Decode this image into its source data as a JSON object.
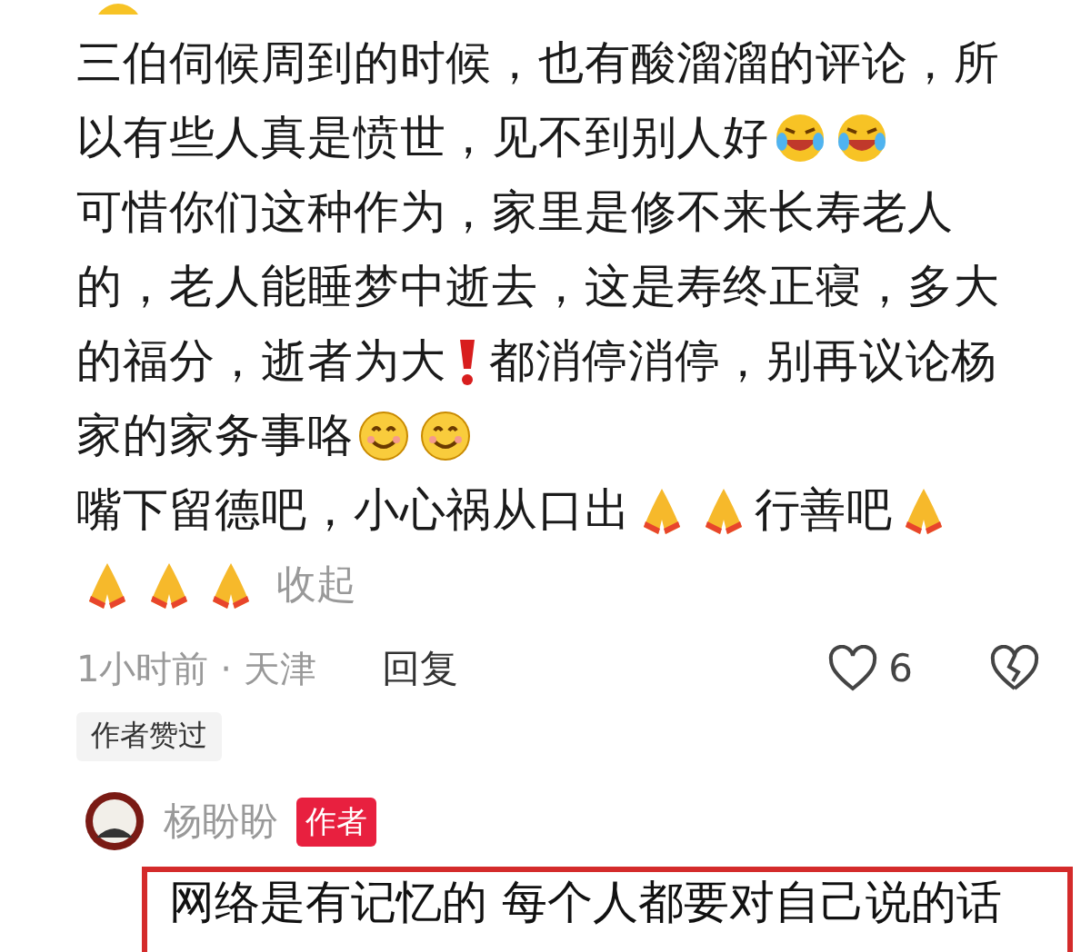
{
  "comment": {
    "lines": [
      [
        {
          "kind": "text",
          "text": "三伯伺候周到的时候，也有酸溜溜的评论，所"
        }
      ],
      [
        {
          "kind": "text",
          "text": "以有些人真是愤世，见不到别人好"
        },
        {
          "kind": "laugh"
        },
        {
          "kind": "laugh"
        }
      ],
      [
        {
          "kind": "text",
          "text": "可惜你们这种作为，家里是修不来长寿老人"
        }
      ],
      [
        {
          "kind": "text",
          "text": "的，老人能睡梦中逝去，这是寿终正寝，多大"
        }
      ],
      [
        {
          "kind": "text",
          "text": "的福分，逝者为大"
        },
        {
          "kind": "exclamation"
        },
        {
          "kind": "text",
          "text": "都消停消停，别再议论杨"
        }
      ],
      [
        {
          "kind": "text",
          "text": "家的家务事咯"
        },
        {
          "kind": "smile"
        },
        {
          "kind": "smile"
        }
      ],
      [
        {
          "kind": "text",
          "text": "嘴下留德吧，小心祸从口出"
        },
        {
          "kind": "pray"
        },
        {
          "kind": "pray"
        },
        {
          "kind": "text",
          "text": "行善吧"
        },
        {
          "kind": "pray"
        }
      ],
      [
        {
          "kind": "pray"
        },
        {
          "kind": "pray"
        },
        {
          "kind": "pray"
        },
        {
          "kind": "collapse",
          "text": "收起"
        }
      ]
    ],
    "time_location": "1小时前 · 天津",
    "reply": "回复",
    "likes": "6",
    "liked": false,
    "author_liked": "作者赞过"
  },
  "author_reply": {
    "name": "杨盼盼",
    "badge": "作者",
    "text": "网络是有记忆的 每个人都要对自己说的话"
  }
}
